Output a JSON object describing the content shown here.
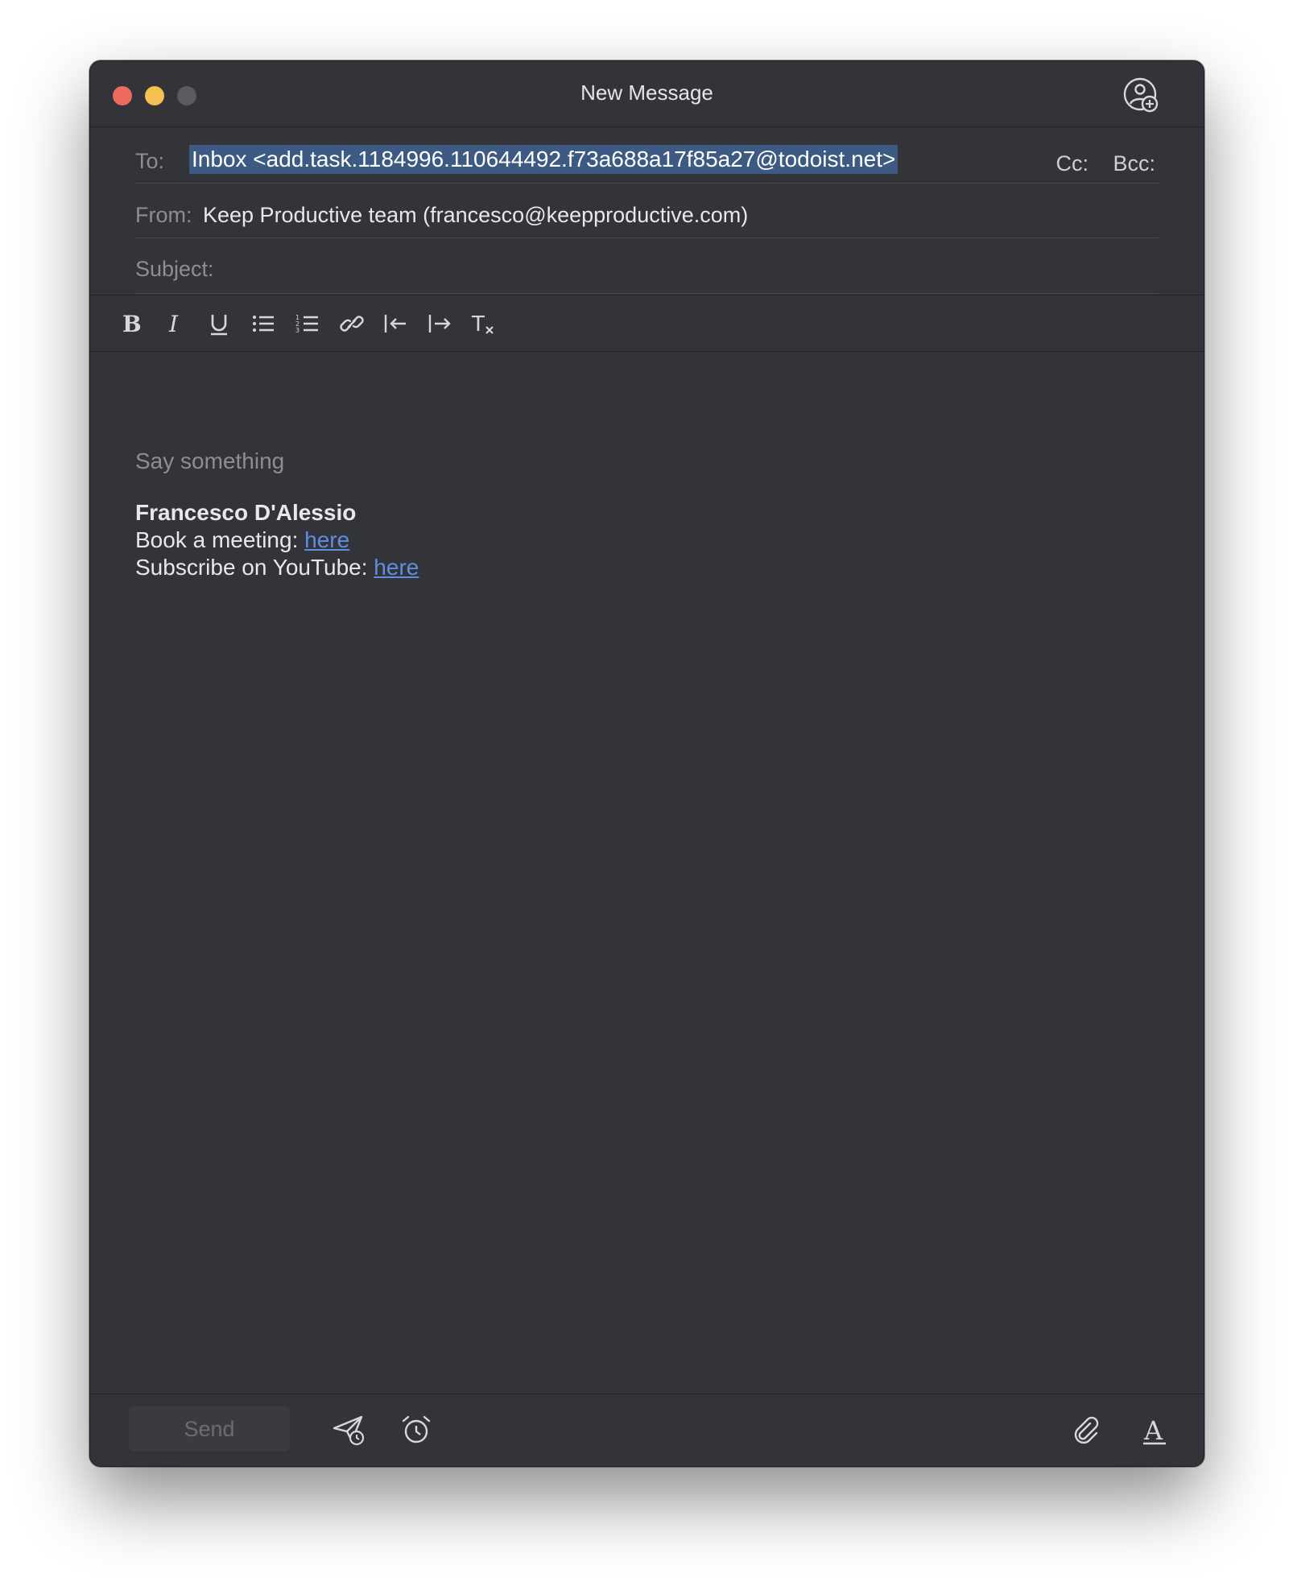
{
  "window": {
    "title": "New Message"
  },
  "compose": {
    "to_label": "To:",
    "to_value": "Inbox <add.task.1184996.110644492.f73a688a17f85a27@todoist.net>",
    "cc_label": "Cc:",
    "bcc_label": "Bcc:",
    "from_label": "From:",
    "from_value": "Keep Productive team (francesco@keepproductive.com)",
    "subject_label": "Subject:",
    "subject_value": ""
  },
  "toolbar": {
    "items": [
      "bold-icon",
      "italic-icon",
      "underline-icon",
      "bulleted-list-icon",
      "numbered-list-icon",
      "link-icon",
      "outdent-icon",
      "indent-icon",
      "clear-format-icon"
    ]
  },
  "body": {
    "placeholder": "Say something",
    "signature": {
      "name": "Francesco D'Alessio",
      "line1_prefix": "Book a meeting: ",
      "line1_link": "here",
      "line2_prefix": "Subscribe on YouTube: ",
      "line2_link": "here"
    }
  },
  "footer": {
    "send_label": "Send",
    "icons": [
      "send-later-icon",
      "reminder-icon",
      "attachment-icon",
      "font-format-icon"
    ]
  },
  "colors": {
    "window_bg": "#33343a",
    "selection": "#3d5a82",
    "link": "#5f8ee0",
    "close": "#ed6a5e",
    "minimize": "#f5c04f"
  }
}
